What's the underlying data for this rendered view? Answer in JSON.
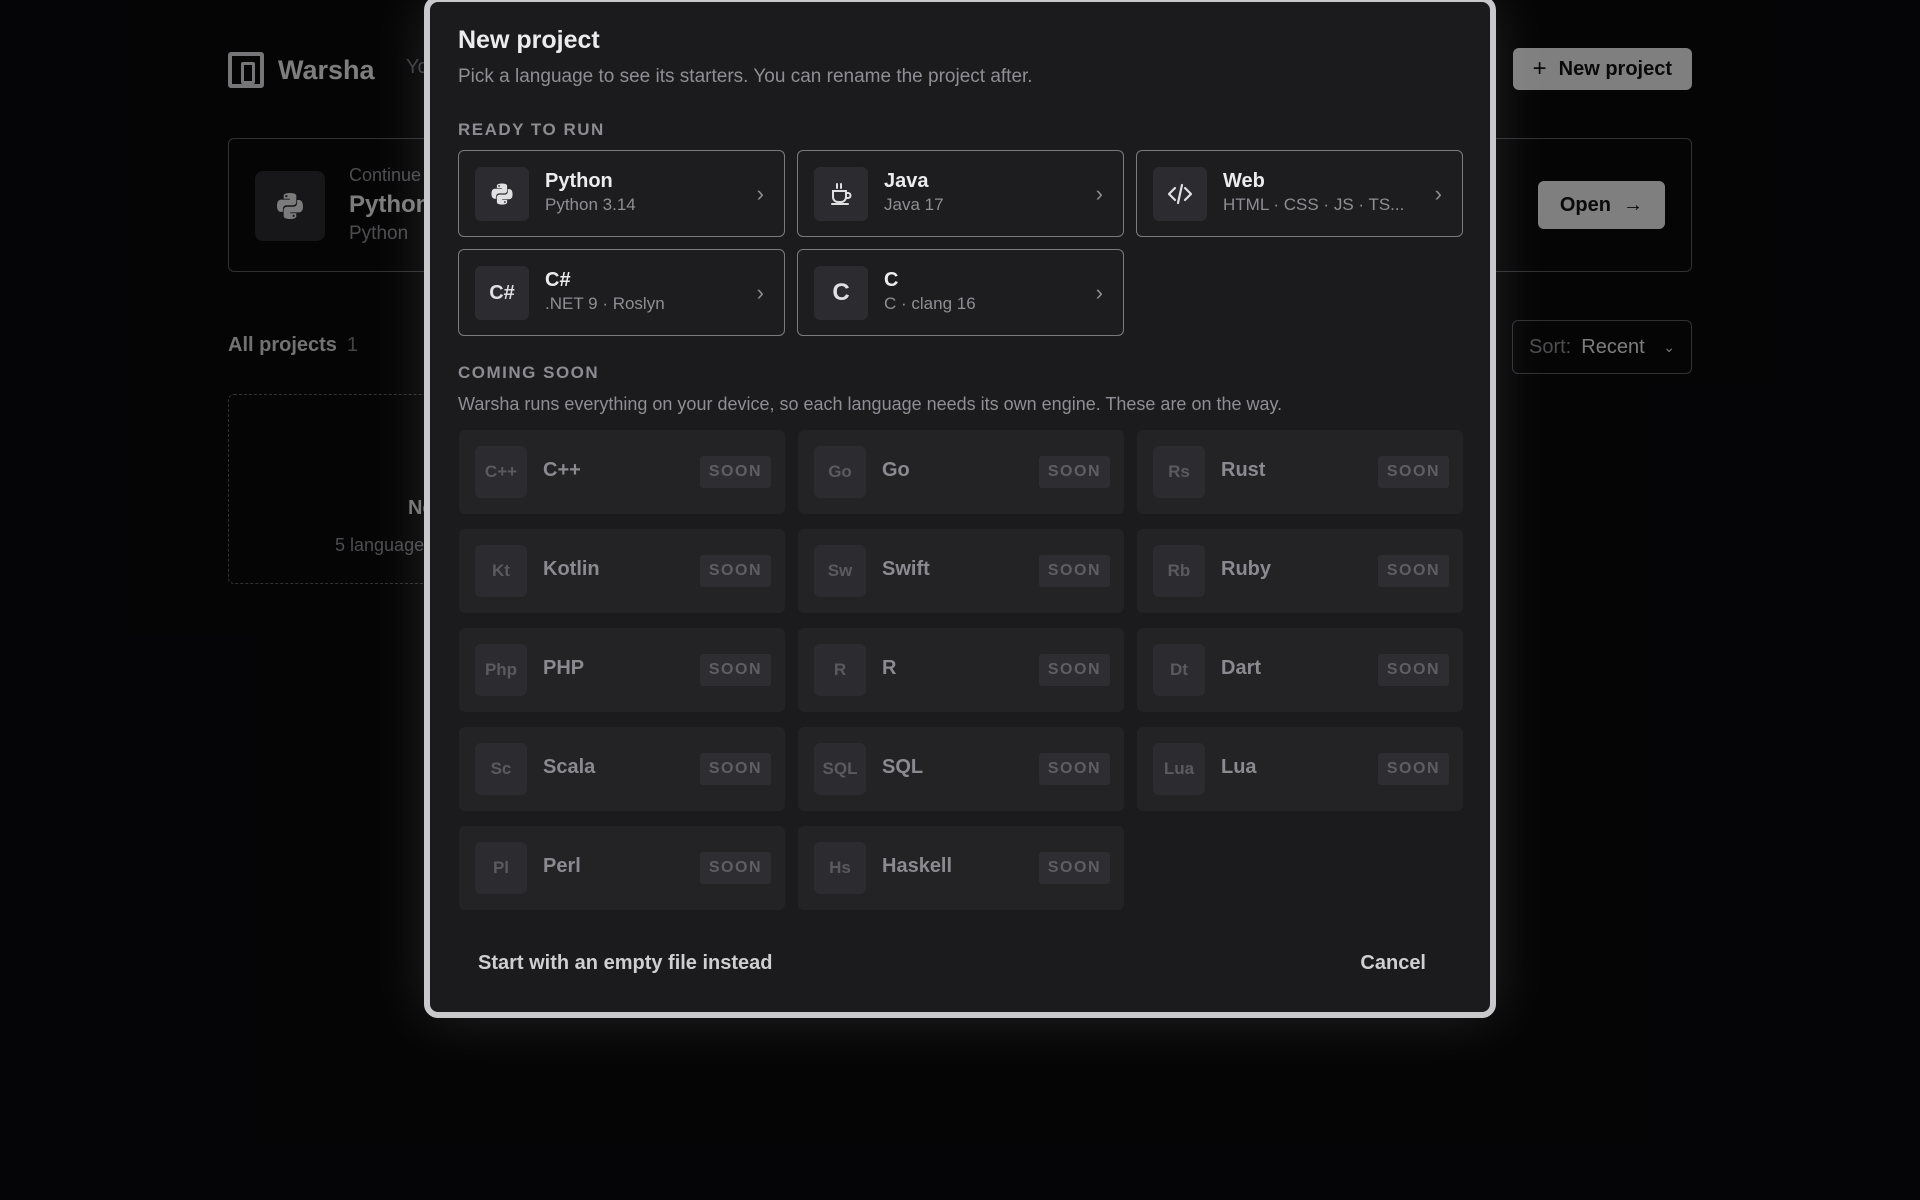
{
  "app": {
    "brand": "Warsha",
    "brand_tail": "Yo",
    "new_project_label": "New project"
  },
  "continue_card": {
    "label": "Continue",
    "title": "Python",
    "subtitle": "Python",
    "open_label": "Open"
  },
  "projects": {
    "heading": "All projects",
    "count": "1",
    "sort_label": "Sort:",
    "sort_value": "Recent",
    "new_card_title": "Ne",
    "new_card_sub": "5 language"
  },
  "modal": {
    "title": "New project",
    "subtitle": "Pick a language to see its starters. You can rename the project after.",
    "ready_label": "READY TO RUN",
    "soon_label": "COMING SOON",
    "soon_desc": "Warsha runs everything on your device, so each language needs its own engine. These are on the way.",
    "soon_badge": "SOON",
    "empty_file_label": "Start with an empty file instead",
    "cancel_label": "Cancel",
    "ready": [
      {
        "name": "Python",
        "meta": "Python 3.14",
        "icon": "python-icon"
      },
      {
        "name": "Java",
        "meta": "Java 17",
        "icon": "coffee-cup-icon"
      },
      {
        "name": "Web",
        "meta": "HTML · CSS · JS · TS...",
        "icon": "code-brackets-icon"
      },
      {
        "name": "C#",
        "meta": ".NET 9 · Roslyn",
        "icon": "csharp-icon",
        "glyph": "C#"
      },
      {
        "name": "C",
        "meta": "C · clang 16",
        "icon": "c-icon",
        "glyph": "C"
      }
    ],
    "soon": [
      {
        "abbr": "C++",
        "name": "C++"
      },
      {
        "abbr": "Go",
        "name": "Go"
      },
      {
        "abbr": "Rs",
        "name": "Rust"
      },
      {
        "abbr": "Kt",
        "name": "Kotlin"
      },
      {
        "abbr": "Sw",
        "name": "Swift"
      },
      {
        "abbr": "Rb",
        "name": "Ruby"
      },
      {
        "abbr": "Php",
        "name": "PHP"
      },
      {
        "abbr": "R",
        "name": "R"
      },
      {
        "abbr": "Dt",
        "name": "Dart"
      },
      {
        "abbr": "Sc",
        "name": "Scala"
      },
      {
        "abbr": "SQL",
        "name": "SQL"
      },
      {
        "abbr": "Lua",
        "name": "Lua"
      },
      {
        "abbr": "Pl",
        "name": "Perl"
      },
      {
        "abbr": "Hs",
        "name": "Haskell"
      }
    ]
  }
}
